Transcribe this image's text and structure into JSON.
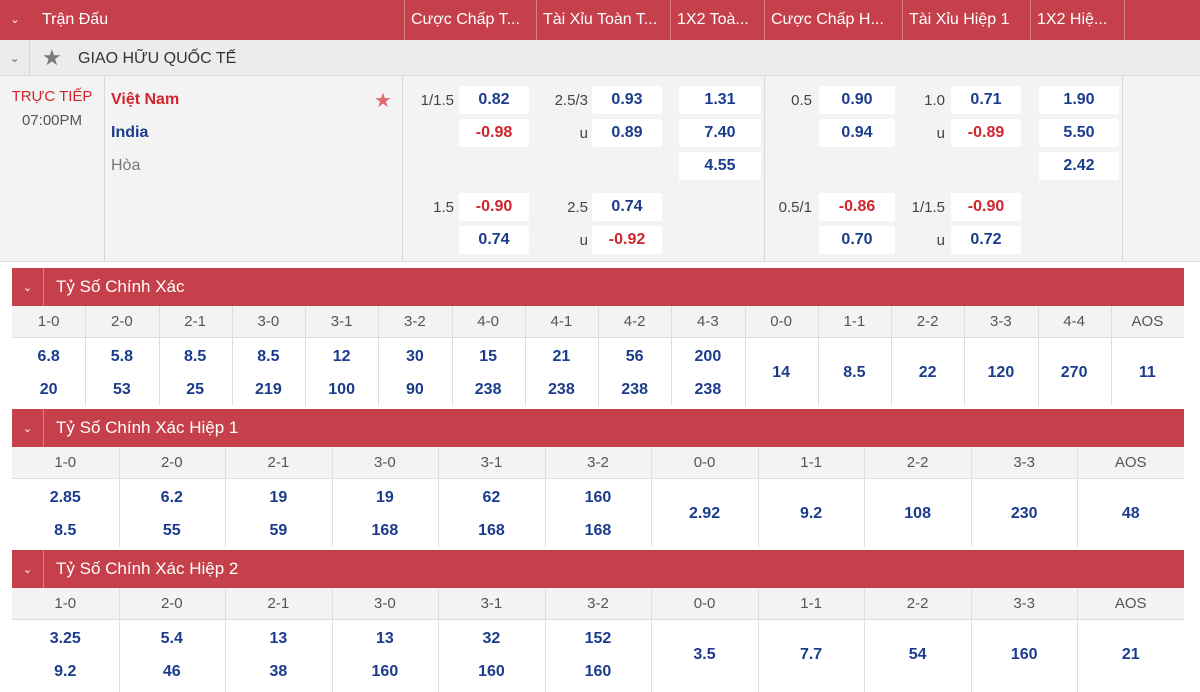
{
  "header": {
    "columns": [
      "Trận Đấu",
      "Cược Chấp T...",
      "Tài Xỉu Toàn T...",
      "1X2 Toà...",
      "Cược Chấp H...",
      "Tài Xỉu Hiệp 1",
      "1X2 Hiệ..."
    ]
  },
  "league": {
    "name": "GIAO HỮU QUỐC TẾ"
  },
  "match": {
    "status": "TRỰC TIẾP",
    "time": "07:00PM",
    "home": "Việt Nam",
    "away": "India",
    "draw": "Hòa",
    "rows": [
      {
        "ft_hcap_line": "1/1.5",
        "ft_hcap_home": "0.82",
        "ft_hcap_away": "-0.98",
        "ft_ou_line": "2.5/3",
        "ft_ou_over": "0.93",
        "ft_ou_u": "u",
        "ft_ou_under": "0.89",
        "ft_1x2_home": "1.31",
        "ft_1x2_away": "7.40",
        "ft_1x2_draw": "4.55",
        "h1_hcap_line": "0.5",
        "h1_hcap_home": "0.90",
        "h1_hcap_away": "0.94",
        "h1_ou_line": "1.0",
        "h1_ou_over": "0.71",
        "h1_ou_u": "u",
        "h1_ou_under": "-0.89",
        "h1_1x2_home": "1.90",
        "h1_1x2_away": "5.50",
        "h1_1x2_draw": "2.42"
      },
      {
        "ft_hcap_line": "1.5",
        "ft_hcap_home": "-0.90",
        "ft_hcap_away": "0.74",
        "ft_ou_line": "2.5",
        "ft_ou_over": "0.74",
        "ft_ou_u": "u",
        "ft_ou_under": "-0.92",
        "h1_hcap_line": "0.5/1",
        "h1_hcap_home": "-0.86",
        "h1_hcap_away": "0.70",
        "h1_ou_line": "1/1.5",
        "h1_ou_over": "-0.90",
        "h1_ou_u": "u",
        "h1_ou_under": "0.72"
      }
    ]
  },
  "correct_score": {
    "title": "Tỷ Số Chính Xác",
    "scores": [
      "1-0",
      "2-0",
      "2-1",
      "3-0",
      "3-1",
      "3-2",
      "4-0",
      "4-1",
      "4-2",
      "4-3",
      "0-0",
      "1-1",
      "2-2",
      "3-3",
      "4-4",
      "AOS"
    ],
    "home": [
      "6.8",
      "5.8",
      "8.5",
      "8.5",
      "12",
      "30",
      "15",
      "21",
      "56",
      "200",
      "14",
      "8.5",
      "22",
      "120",
      "270",
      "11"
    ],
    "away": [
      "20",
      "53",
      "25",
      "219",
      "100",
      "90",
      "238",
      "238",
      "238",
      "238",
      "",
      "",
      "",
      "",
      "",
      ""
    ]
  },
  "correct_score_h1": {
    "title": "Tỷ Số Chính Xác Hiệp 1",
    "scores": [
      "1-0",
      "2-0",
      "2-1",
      "3-0",
      "3-1",
      "3-2",
      "0-0",
      "1-1",
      "2-2",
      "3-3",
      "AOS"
    ],
    "home": [
      "2.85",
      "6.2",
      "19",
      "19",
      "62",
      "160",
      "2.92",
      "9.2",
      "108",
      "230",
      "48"
    ],
    "away": [
      "8.5",
      "55",
      "59",
      "168",
      "168",
      "168",
      "",
      "",
      "",
      "",
      ""
    ]
  },
  "correct_score_h2": {
    "title": "Tỷ Số Chính Xác Hiệp 2",
    "scores": [
      "1-0",
      "2-0",
      "2-1",
      "3-0",
      "3-1",
      "3-2",
      "0-0",
      "1-1",
      "2-2",
      "3-3",
      "AOS"
    ],
    "home": [
      "3.25",
      "5.4",
      "13",
      "13",
      "32",
      "152",
      "3.5",
      "7.7",
      "54",
      "160",
      "21"
    ],
    "away": [
      "9.2",
      "46",
      "38",
      "160",
      "160",
      "160",
      "",
      "",
      "",
      "",
      ""
    ]
  },
  "colors": {
    "accent": "#c5404a",
    "home": "#d0252c",
    "away": "#1b3c8c"
  }
}
